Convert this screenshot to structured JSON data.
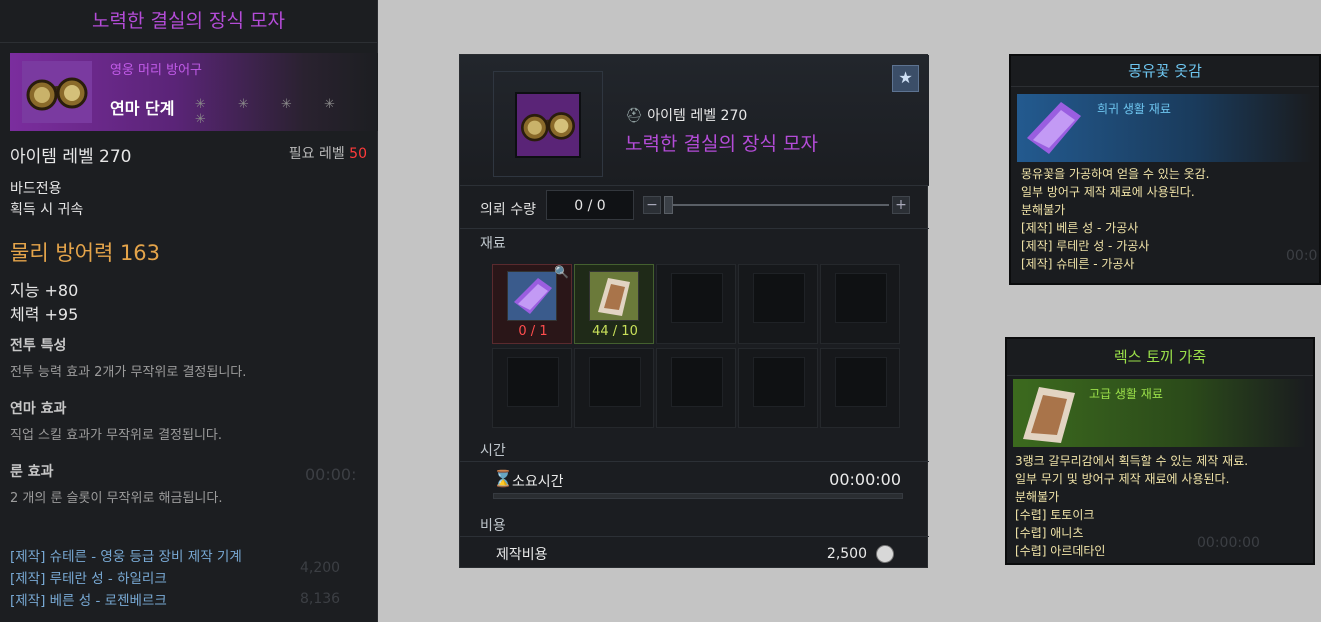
{
  "tooltip": {
    "title": "노력한 결실의 장식 모자",
    "grade": "영웅 머리 방어구",
    "hone_stage": "연마 단계",
    "hone_stars": "✳ ✳ ✳ ✳ ✳",
    "item_level": "아이템 레벨 270",
    "req_level_label": "필요 레벨",
    "req_level_value": "50",
    "class_only": "바드전용",
    "bind": "획득 시 귀속",
    "defense": "물리 방어력 163",
    "stat1": "지능 +80",
    "stat2": "체력 +95",
    "combat_title": "전투 특성",
    "combat_desc": "전투 능력 효과 2개가 무작위로 결정됩니다.",
    "hone_title": "연마 효과",
    "hone_desc": "직업 스킬 효과가 무작위로 결정됩니다.",
    "rune_title": "룬 효과",
    "rune_desc": "2 개의 룬 슬롯이 무작위로 해금됩니다.",
    "crafts": [
      "[제작] 슈테른 - 영웅 등급 장비 제작 기계",
      "[제작] 루테란 성 - 하일리크",
      "[제작] 베른 성 - 로젠베르크"
    ],
    "bg_time": "00:00:",
    "bg_n1": "4,200",
    "bg_n2": "8,136"
  },
  "craft": {
    "item_level": "아이템 레벨 270",
    "item_name": "노력한 결실의 장식 모자",
    "favorite_icon": "★",
    "quantity_label": "의뢰 수량",
    "quantity_value": "0 / 0",
    "minus": "−",
    "plus": "+",
    "materials_label": "재료",
    "mat1_count": "0 / 1",
    "mat2_count": "44 / 10",
    "time_label": "시간",
    "duration_label": "소요시간",
    "duration_value": "00:00:00",
    "cost_label": "비용",
    "cost_name": "제작비용",
    "cost_value": "2,500",
    "colors": {
      "accent": "#b44cd8",
      "bad": "#ff4d4d",
      "good": "#c8e05a"
    }
  },
  "mat1": {
    "title": "몽유꽃 옷감",
    "type": "희귀 생활 재료",
    "desc1": "몽유꽃을 가공하여 얻을 수 있는 옷감.",
    "desc2": "일부 방어구 제작 재료에 사용된다.",
    "nodis": "분해불가",
    "src": [
      "[제작] 베른 성 - 가공사",
      "[제작] 루테란 성 - 가공사",
      "[제작] 슈테른 - 가공사"
    ],
    "bg_time": "00:0"
  },
  "mat2": {
    "title": "렉스 토끼 가죽",
    "type": "고급 생활 재료",
    "desc1": "3랭크 갈무리감에서 획득할 수 있는 제작 재료.",
    "desc2": "일부 무기 및 방어구 제작 재료에 사용된다.",
    "nodis": "분해불가",
    "src": [
      "[수렵] 토토이크",
      "[수렵] 애니츠",
      "[수렵] 아르데타인"
    ],
    "bg_time": "00:00:00"
  }
}
